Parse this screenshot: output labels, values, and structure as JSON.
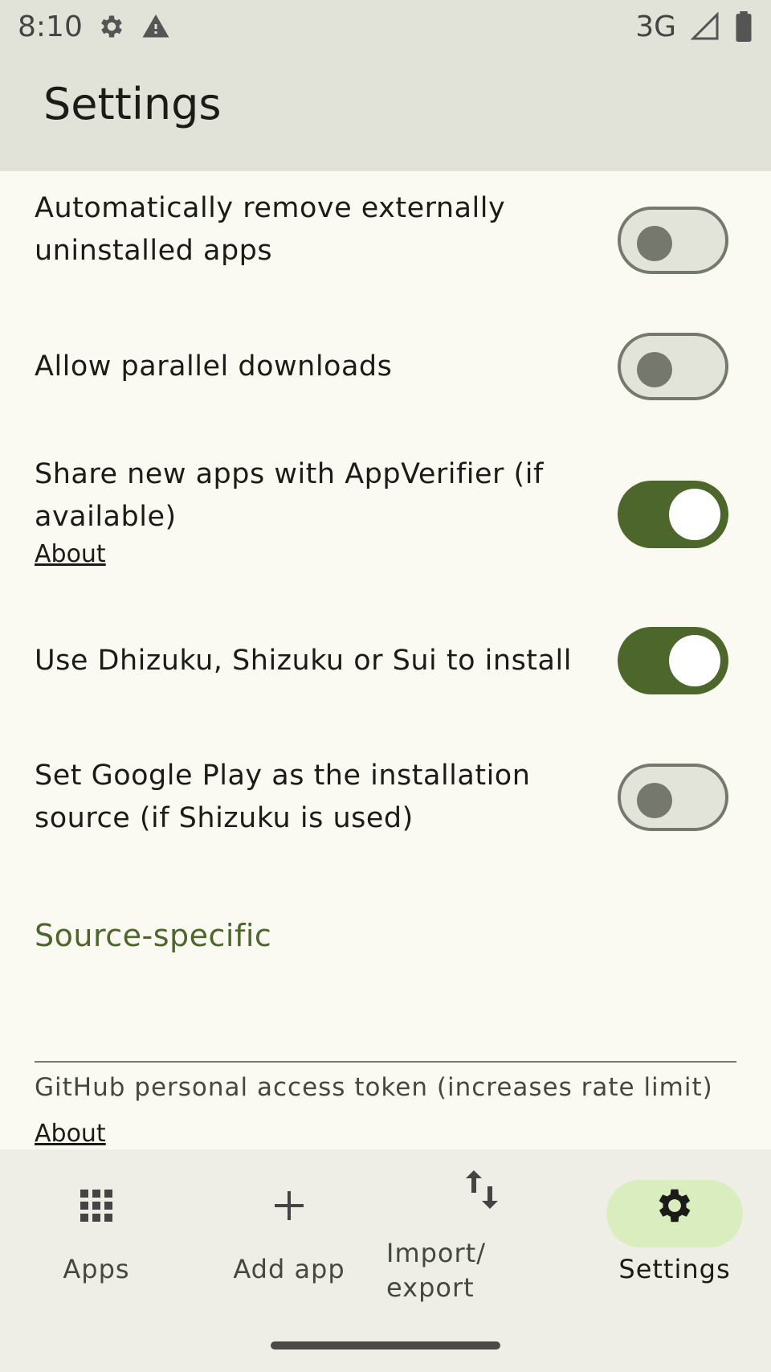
{
  "status_bar": {
    "time": "8:10",
    "network": "3G",
    "icons": [
      "gear-icon",
      "warning-icon",
      "signal-icon",
      "battery-icon"
    ]
  },
  "app_bar": {
    "title": "Settings"
  },
  "settings": [
    {
      "label": "Automatically remove externally uninstalled apps",
      "enabled": false
    },
    {
      "label": "Allow parallel downloads",
      "enabled": false
    },
    {
      "label": "Share new apps with AppVerifier (if available)",
      "about": "About",
      "enabled": true
    },
    {
      "label": "Use Dhizuku, Shizuku or Sui to install",
      "enabled": true
    },
    {
      "label": "Set Google Play as the installation source (if Shizuku is used)",
      "enabled": false
    }
  ],
  "section": {
    "title": "Source-specific",
    "token_label": "GitHub personal access token (increases rate limit)",
    "token_about": "About"
  },
  "nav": [
    {
      "label": "Apps",
      "icon": "grid-icon"
    },
    {
      "label": "Add app",
      "icon": "plus-icon"
    },
    {
      "label": "Import/\nexport",
      "icon": "swap-vertical-icon"
    },
    {
      "label": "Settings",
      "icon": "gear-icon",
      "active": true
    }
  ],
  "colors": {
    "accent": "#4c662b",
    "switch_off": "#75786c",
    "bar_bg": "#e2e3d8",
    "page_bg": "#fafaf3"
  }
}
